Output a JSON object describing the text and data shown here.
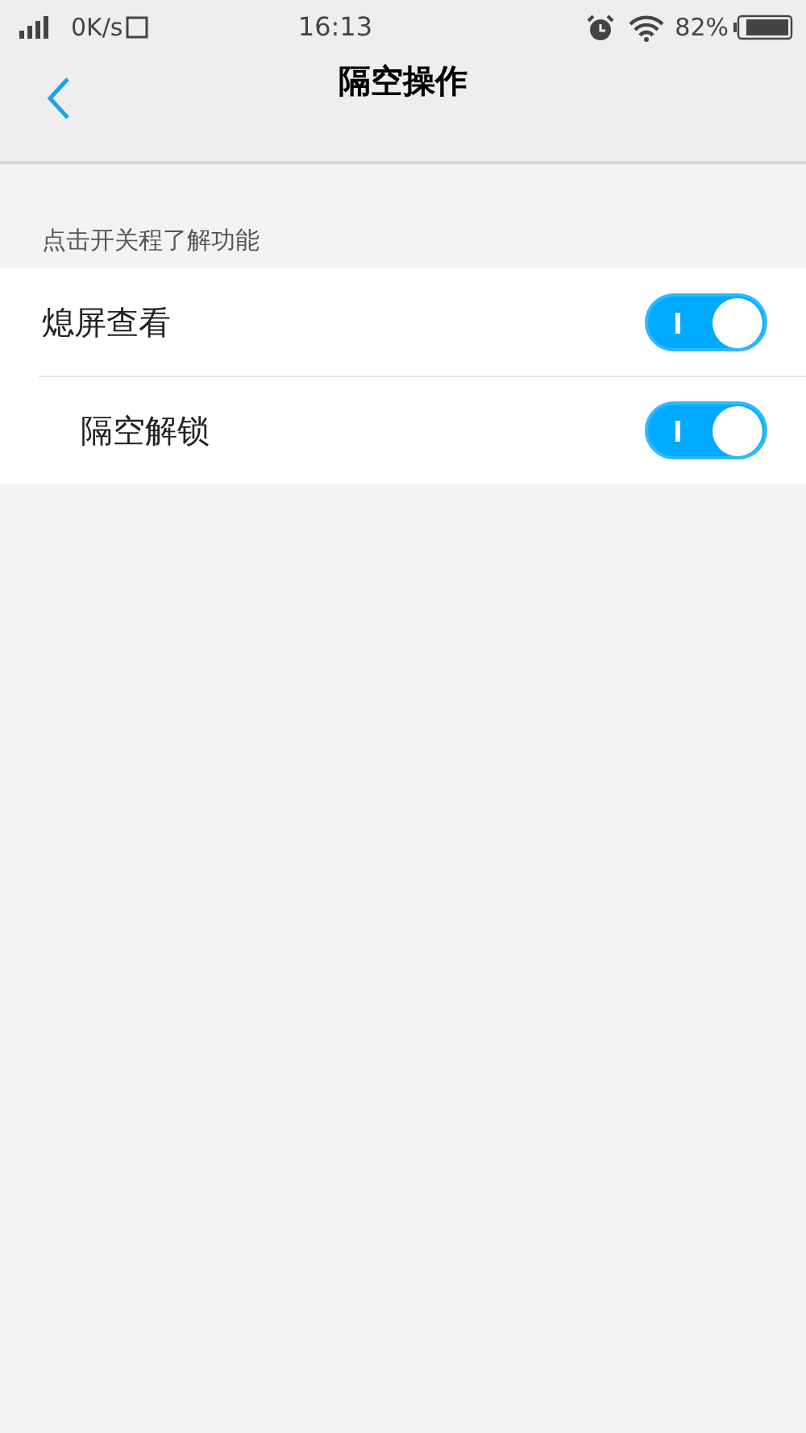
{
  "status_bar": {
    "speed": "0K/s",
    "time": "16:13",
    "battery": "82%"
  },
  "header": {
    "title": "隔空操作"
  },
  "section": {
    "caption": "点击开关程了解功能"
  },
  "settings": [
    {
      "label": "熄屏查看",
      "on": true
    },
    {
      "label": "隔空解锁",
      "on": true
    }
  ]
}
